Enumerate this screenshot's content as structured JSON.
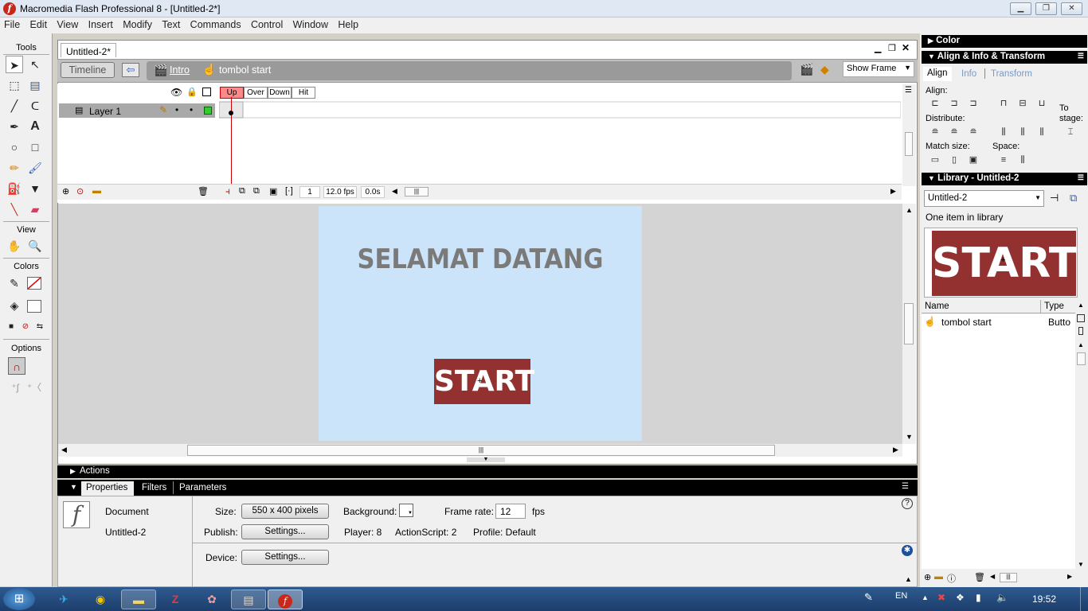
{
  "window": {
    "title": "Macromedia Flash Professional 8 - [Untitled-2*]",
    "app_icon": "flash-icon",
    "controls": [
      "minimize-icon",
      "restore-icon",
      "close-icon"
    ]
  },
  "menu": [
    "File",
    "Edit",
    "View",
    "Insert",
    "Modify",
    "Text",
    "Commands",
    "Control",
    "Window",
    "Help"
  ],
  "tools": {
    "title": "Tools",
    "view_label": "View",
    "colors_label": "Colors",
    "options_label": "Options"
  },
  "document": {
    "tab_label": "Untitled-2*",
    "timeline_button": "Timeline",
    "breadcrumb_scene": "Intro",
    "breadcrumb_symbol": "tombol start",
    "zoom_select": "Show Frame"
  },
  "timeline": {
    "frame_states": [
      "Up",
      "Over",
      "Down",
      "Hit"
    ],
    "layer_name": "Layer 1",
    "current_frame": "1",
    "fps": "12.0 fps",
    "elapsed": "0.0s"
  },
  "stage": {
    "heading": "SELAMAT DATANG",
    "button_label": "START",
    "background_color": "#cce4fa",
    "button_color": "#933131"
  },
  "actions_panel": {
    "title": "Actions"
  },
  "properties": {
    "tabs": [
      "Properties",
      "Filters",
      "Parameters"
    ],
    "doc_type": "Document",
    "doc_name": "Untitled-2",
    "size_label": "Size:",
    "size_value": "550 x 400 pixels",
    "background_label": "Background:",
    "frame_rate_label": "Frame rate:",
    "frame_rate_value": "12",
    "fps_unit": "fps",
    "publish_label": "Publish:",
    "settings_button": "Settings...",
    "player": "Player: 8",
    "actionscript": "ActionScript:  2",
    "profile": "Profile:  Default",
    "device_label": "Device:",
    "device_settings_button": "Settings..."
  },
  "right_panels": {
    "color_title": "Color",
    "align_title": "Align & Info & Transform",
    "align_tabs": [
      "Align",
      "Info",
      "Transform"
    ],
    "align_label": "Align:",
    "distribute_label": "Distribute:",
    "match_size_label": "Match size:",
    "space_label": "Space:",
    "to_stage_label": "To stage:",
    "library_title": "Library - Untitled-2",
    "library_select": "Untitled-2",
    "library_count": "One item in library",
    "library_preview_text": "START",
    "library_columns": [
      "Name",
      "Type"
    ],
    "library_items": [
      {
        "name": "tombol start",
        "type": "Butto"
      }
    ]
  },
  "taskbar": {
    "language": "EN",
    "clock": "19:52"
  }
}
